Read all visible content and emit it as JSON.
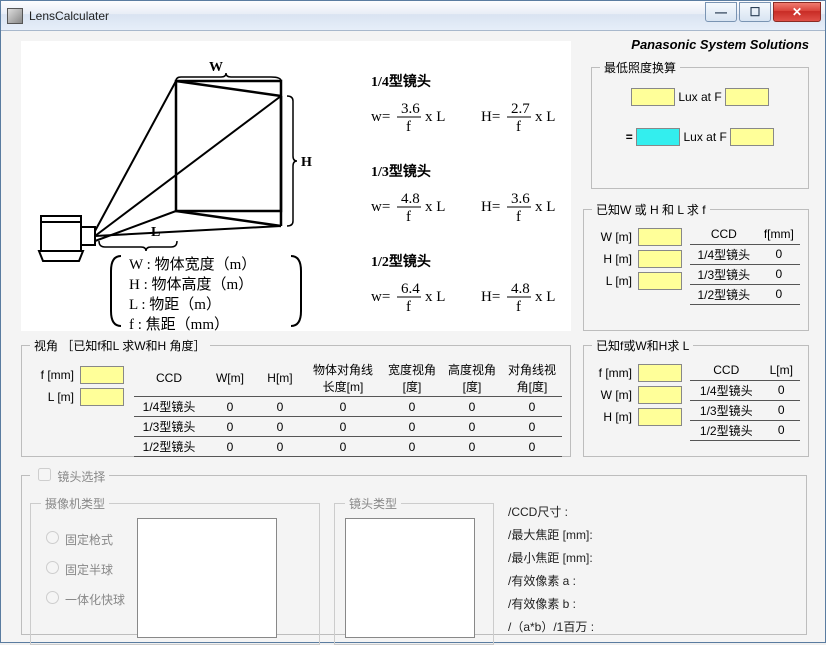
{
  "window": {
    "title": "LensCalculater"
  },
  "brand": "Panasonic System Solutions",
  "diagram": {
    "labels": {
      "W": "W",
      "H": "H",
      "L": "L"
    },
    "defs": {
      "W": "物体宽度（m）",
      "H": "物体高度（m）",
      "L": "物距（m）",
      "f": "焦距（mm）"
    },
    "sections": [
      {
        "title": "1/4型镜头",
        "w_num": "3.6",
        "h_num": "2.7"
      },
      {
        "title": "1/3型镜头",
        "w_num": "4.8",
        "h_num": "3.6"
      },
      {
        "title": "1/2型镜头",
        "w_num": "6.4",
        "h_num": "4.8"
      }
    ]
  },
  "lux": {
    "legend": "最低照度换算",
    "label1": "Lux at F",
    "eq": "=",
    "label2": "Lux at F"
  },
  "calc_f": {
    "legend": "已知W 或 H 和 L 求 f",
    "rows": [
      {
        "lab": "W [m]"
      },
      {
        "lab": "H [m]"
      },
      {
        "lab": "L [m]"
      }
    ],
    "tbl_head": [
      "CCD",
      "f[mm]"
    ],
    "tbl_rows": [
      {
        "ccd": "1/4型镜头",
        "v": "0"
      },
      {
        "ccd": "1/3型镜头",
        "v": "0"
      },
      {
        "ccd": "1/2型镜头",
        "v": "0"
      }
    ]
  },
  "angle": {
    "legend": "视角 ［已知f和L 求W和H  角度］",
    "inputs": [
      {
        "lab": "f [mm]"
      },
      {
        "lab": "L [m]"
      }
    ],
    "head": [
      "CCD",
      "W[m]",
      "H[m]",
      "物体对角线长度[m]",
      "宽度视角[度]",
      "高度视角[度]",
      "对角线视角[度]"
    ],
    "rows": [
      {
        "ccd": "1/4型镜头",
        "v": [
          "0",
          "0",
          "0",
          "0",
          "0",
          "0"
        ]
      },
      {
        "ccd": "1/3型镜头",
        "v": [
          "0",
          "0",
          "0",
          "0",
          "0",
          "0"
        ]
      },
      {
        "ccd": "1/2型镜头",
        "v": [
          "0",
          "0",
          "0",
          "0",
          "0",
          "0"
        ]
      }
    ]
  },
  "calc_L": {
    "legend": "已知f或W和H求 L",
    "rows": [
      {
        "lab": "f [mm]"
      },
      {
        "lab": "W [m]"
      },
      {
        "lab": "H [m]"
      }
    ],
    "tbl_head": [
      "CCD",
      "L[m]"
    ],
    "tbl_rows": [
      {
        "ccd": "1/4型镜头",
        "v": "0"
      },
      {
        "ccd": "1/3型镜头",
        "v": "0"
      },
      {
        "ccd": "1/2型镜头",
        "v": "0"
      }
    ]
  },
  "lens": {
    "legend": "镜头选择",
    "cam_legend": "摄像机类型",
    "lens_legend": "镜头类型",
    "radios": [
      "固定枪式",
      "固定半球",
      "一体化快球"
    ],
    "specs": [
      "/CCD尺寸    :",
      "/最大焦距 [mm]:",
      "/最小焦距 [mm]:",
      "/有效像素 a   :",
      "/有效像素 b   :",
      "/（a*b）/1百万 :"
    ]
  }
}
